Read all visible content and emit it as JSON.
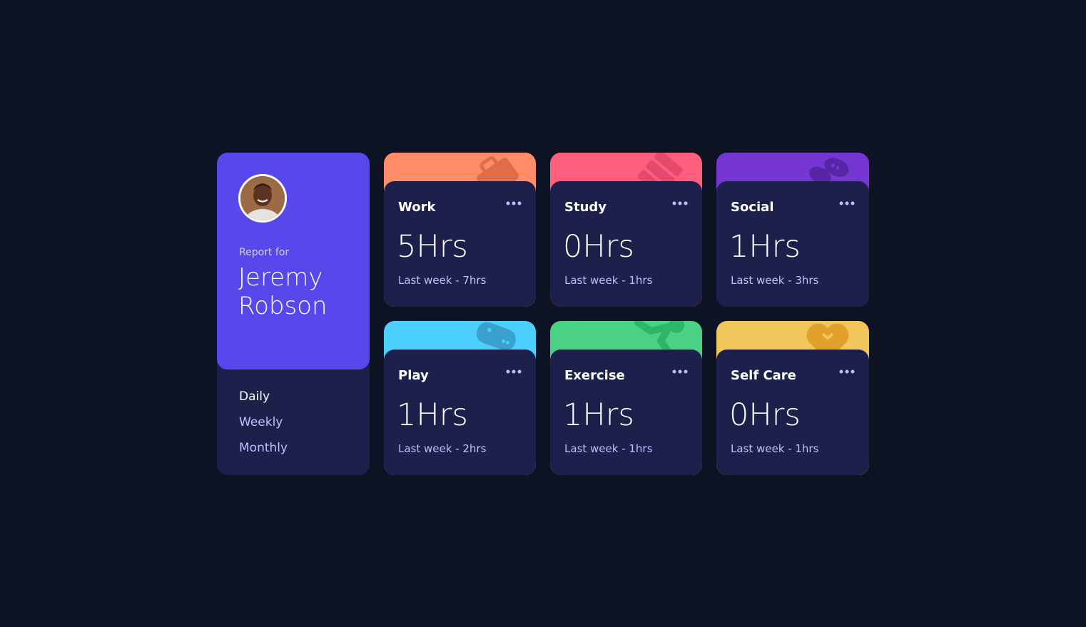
{
  "profile": {
    "report_label": "Report for",
    "name": "Jeremy Robson",
    "avatar_icon": "person-avatar"
  },
  "periods": [
    {
      "label": "Daily",
      "active": true
    },
    {
      "label": "Weekly",
      "active": false
    },
    {
      "label": "Monthly",
      "active": false
    }
  ],
  "cards": [
    {
      "title": "Work",
      "current": "5Hrs",
      "previous": "Last week - 7hrs",
      "color": "#ff8c66",
      "icon": "briefcase-icon"
    },
    {
      "title": "Study",
      "current": "0Hrs",
      "previous": "Last week - 1hrs",
      "color": "#ff5e7d",
      "icon": "books-icon"
    },
    {
      "title": "Social",
      "current": "1Hrs",
      "previous": "Last week - 3hrs",
      "color": "#7536d3",
      "icon": "chat-bubbles-icon"
    },
    {
      "title": "Play",
      "current": "1Hrs",
      "previous": "Last week - 2hrs",
      "color": "#4bcfff",
      "icon": "gamepad-icon"
    },
    {
      "title": "Exercise",
      "current": "1Hrs",
      "previous": "Last week - 1hrs",
      "color": "#4bd183",
      "icon": "running-person-icon"
    },
    {
      "title": "Self Care",
      "current": "0Hrs",
      "previous": "Last week - 1hrs",
      "color": "#f1c65b",
      "icon": "heart-icon"
    }
  ],
  "theme": {
    "background": "#0e1323",
    "card_body": "#1c204b",
    "profile_accent": "#5847eb",
    "muted_text": "#bbc0ff"
  }
}
